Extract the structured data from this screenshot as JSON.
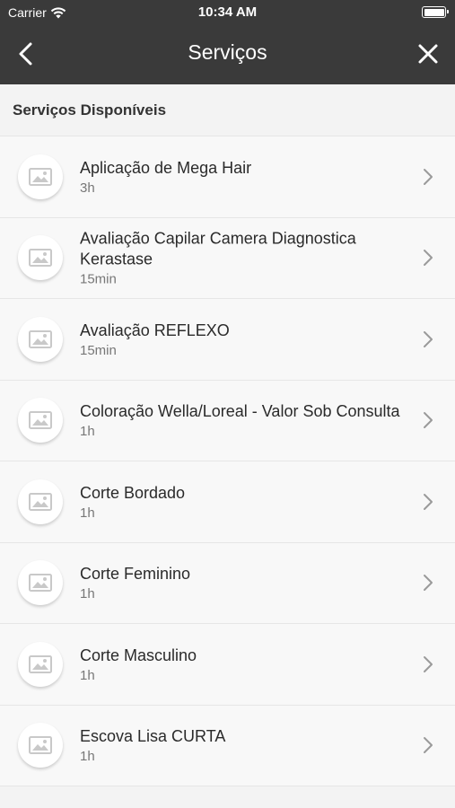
{
  "status_bar": {
    "carrier": "Carrier",
    "time": "10:34 AM",
    "wifi_icon": "wifi-icon",
    "battery_icon": "battery-icon"
  },
  "nav": {
    "title": "Serviços",
    "back_icon": "chevron-left-icon",
    "close_icon": "close-icon"
  },
  "section_title": "Serviços Disponíveis",
  "services": [
    {
      "name": "Aplicação de Mega Hair",
      "duration": "3h"
    },
    {
      "name": "Avaliação Capilar Camera Diagnostica Kerastase",
      "duration": "15min"
    },
    {
      "name": "Avaliação REFLEXO",
      "duration": "15min"
    },
    {
      "name": "Coloração Wella/Loreal - Valor Sob Consulta",
      "duration": "1h"
    },
    {
      "name": "Corte Bordado",
      "duration": "1h"
    },
    {
      "name": "Corte Feminino",
      "duration": "1h"
    },
    {
      "name": "Corte Masculino",
      "duration": "1h"
    },
    {
      "name": "Escova Lisa CURTA",
      "duration": "1h"
    }
  ],
  "colors": {
    "header_bg": "#3a3a3a",
    "list_bg": "#f8f8f8",
    "divider": "#e6e6e6"
  }
}
